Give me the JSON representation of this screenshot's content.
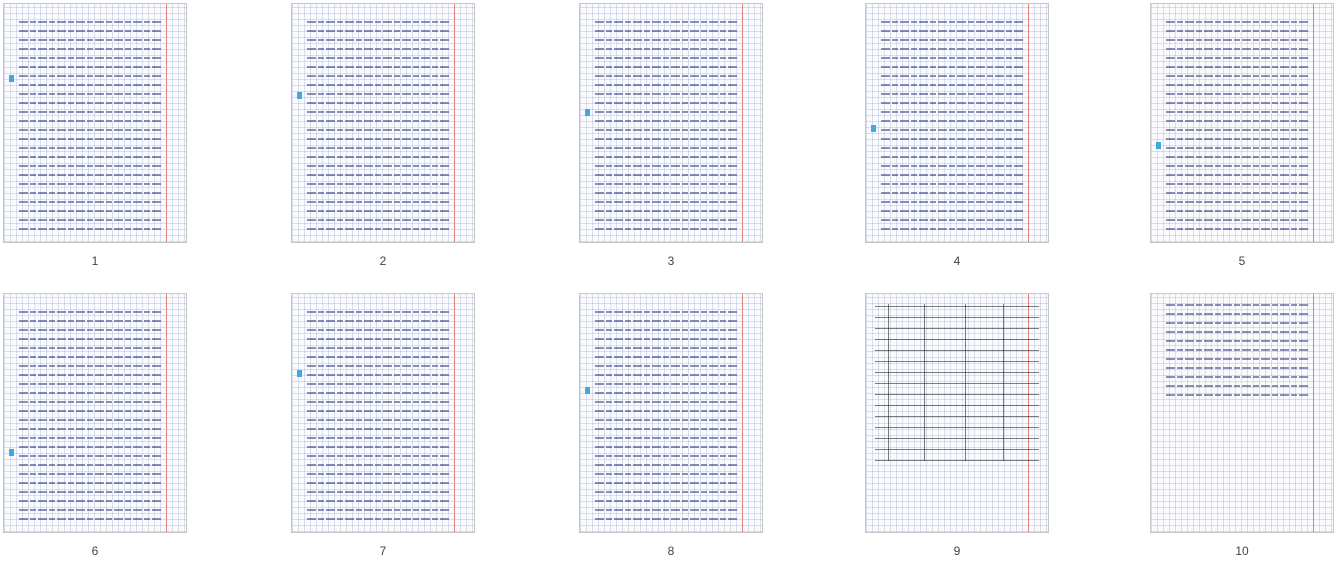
{
  "gallery": {
    "pages": [
      {
        "number": "1",
        "style": "notes"
      },
      {
        "number": "2",
        "style": "notes"
      },
      {
        "number": "3",
        "style": "notes"
      },
      {
        "number": "4",
        "style": "notes"
      },
      {
        "number": "5",
        "style": "notes"
      },
      {
        "number": "6",
        "style": "notes"
      },
      {
        "number": "7",
        "style": "notes"
      },
      {
        "number": "8",
        "style": "notes"
      },
      {
        "number": "9",
        "style": "table"
      },
      {
        "number": "10",
        "style": "sparse"
      }
    ]
  },
  "colors": {
    "ink": "#28377a",
    "margin_line": "#e65a5a",
    "grid": "#96aad2",
    "highlight": "#3fa9e0"
  }
}
